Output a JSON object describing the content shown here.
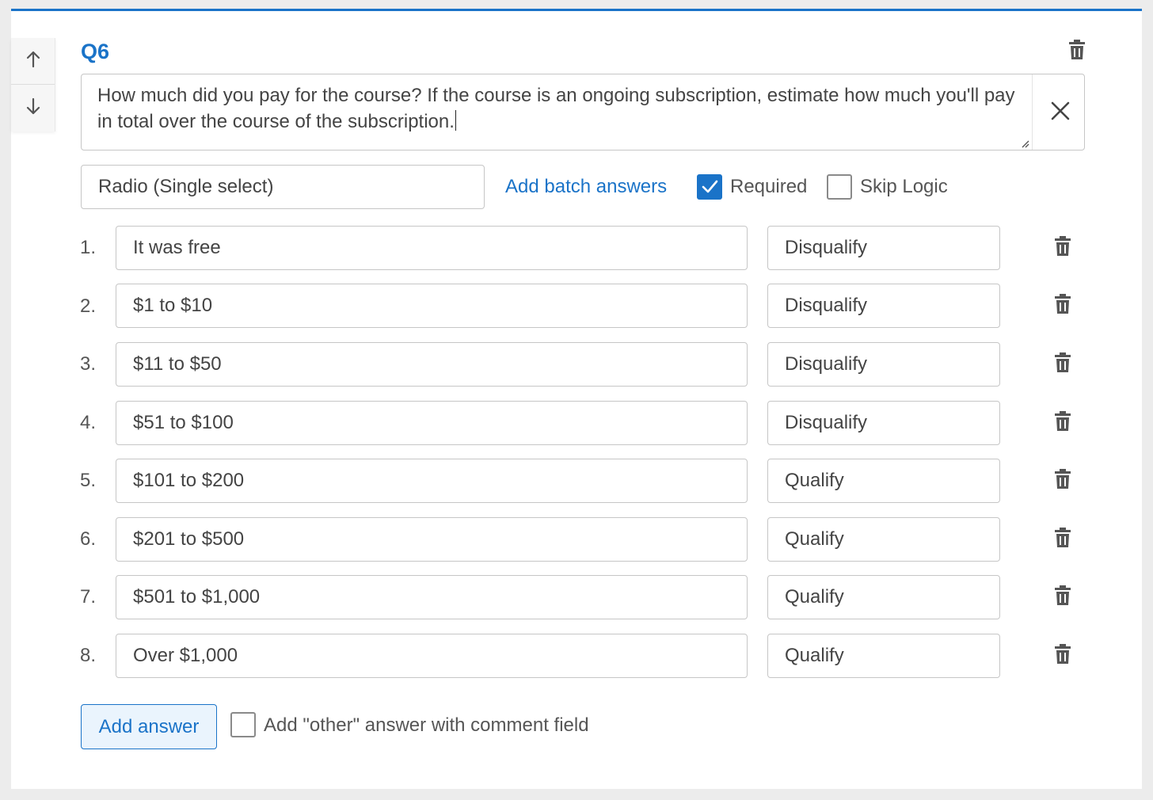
{
  "question": {
    "label": "Q6",
    "text": "How much did you pay for the course? If the course is an ongoing subscription, estimate how much you'll pay in total over the course of the subscription."
  },
  "controls": {
    "type_value": "Radio (Single select)",
    "batch_link": "Add batch answers",
    "required_label": "Required",
    "required_checked": true,
    "skip_logic_label": "Skip Logic",
    "skip_logic_checked": false
  },
  "answers": [
    {
      "num": "1.",
      "text": "It was free",
      "rule": "Disqualify"
    },
    {
      "num": "2.",
      "text": "$1 to $10",
      "rule": "Disqualify"
    },
    {
      "num": "3.",
      "text": "$11 to $50",
      "rule": "Disqualify"
    },
    {
      "num": "4.",
      "text": "$51 to $100",
      "rule": "Disqualify"
    },
    {
      "num": "5.",
      "text": "$101 to $200",
      "rule": "Qualify"
    },
    {
      "num": "6.",
      "text": "$201 to $500",
      "rule": "Qualify"
    },
    {
      "num": "7.",
      "text": "$501 to $1,000",
      "rule": "Qualify"
    },
    {
      "num": "8.",
      "text": "Over $1,000",
      "rule": "Qualify"
    }
  ],
  "footer": {
    "add_answer": "Add answer",
    "other_label": "Add \"other\" answer with comment field",
    "other_checked": false
  },
  "colors": {
    "accent": "#1a73c8",
    "border": "#c6c6c6",
    "icon": "#555555"
  },
  "icons": {
    "move_up": "arrow-up-icon",
    "move_down": "arrow-down-icon",
    "delete": "trash-icon",
    "clear": "close-icon",
    "check": "checkmark-icon"
  }
}
